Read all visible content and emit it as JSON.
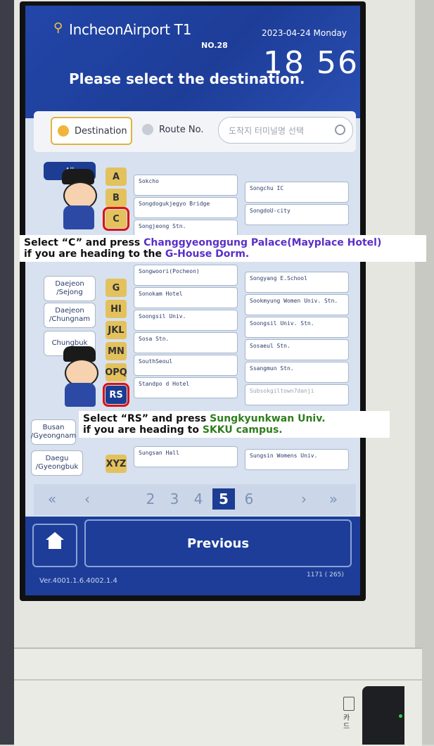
{
  "kiosk": {
    "location": "IncheonAirport T1",
    "number": "NO.28",
    "date": "2023-04-24 Monday",
    "time": "18 56",
    "prompt": "Please select the destination."
  },
  "filters": {
    "destination": "Destination",
    "route_no": "Route No.",
    "search_placeholder": "도착지 터미널명 선택"
  },
  "categories": [
    {
      "label": "All"
    },
    {
      "label": "Daejeon\n/Sejong"
    },
    {
      "label": "Daejeon\n/Chungnam"
    },
    {
      "label": "Chungbuk"
    },
    {
      "label": "Busan\n/Gyeongnam"
    },
    {
      "label": "Daegu\n/Gyeongbuk"
    }
  ],
  "letters": [
    "A",
    "B",
    "C",
    "G",
    "HI",
    "JKL",
    "MN",
    "OPQ",
    "RS",
    "XYZ"
  ],
  "destinations": {
    "left": [
      "Sokcho",
      "Songdogukjegyo Bridge",
      "Songjeong Stn.",
      "Songwoori(Pocheon)",
      "Sonokam Hotel",
      "Soongsil Univ.",
      "Sosa Stn.",
      "SouthSeoul",
      "Standpo d Hotel",
      "Sungsan Hall"
    ],
    "right": [
      "Songchu IC",
      "SongdoU-city",
      "Songyang E.School",
      "Sookmyung Women Univ. Stn.",
      "Soongsil Univ. Stn.",
      "Sosaeul Stn.",
      "Ssangmun Stn.",
      "Subsokgiltown7danji",
      "Sungsin Womens Univ."
    ]
  },
  "pagination": {
    "first": "«",
    "prev": "‹",
    "pages": [
      "2",
      "3",
      "4",
      "5",
      "6"
    ],
    "current": "5",
    "next": "›",
    "last": "»"
  },
  "bottom": {
    "previous": "Previous",
    "version": "Ver.4001.1.6.4002.1.4",
    "count": "1171 ( 265)"
  },
  "callouts": {
    "c1_line1_a": "Select “C” and press ",
    "c1_line1_b": "Changgyeonggung Palace(Mayplace Hotel)",
    "c1_line2_a": "if you are heading to the ",
    "c1_line2_b": "G-House Dorm.",
    "c2_line1_a": "Select “RS” and press ",
    "c2_line1_b": "Sungkyunkwan Univ.",
    "c2_line2_a": "if you are heading to ",
    "c2_line2_b": "SKKU campus."
  },
  "card_reader_label": "카드",
  "colors": {
    "header_blue": "#1d3d98",
    "letter_gold": "#e3c15d",
    "highlight_red": "#dd1111",
    "callout_purple": "#5a2fc8",
    "callout_green": "#2f7d1f"
  }
}
